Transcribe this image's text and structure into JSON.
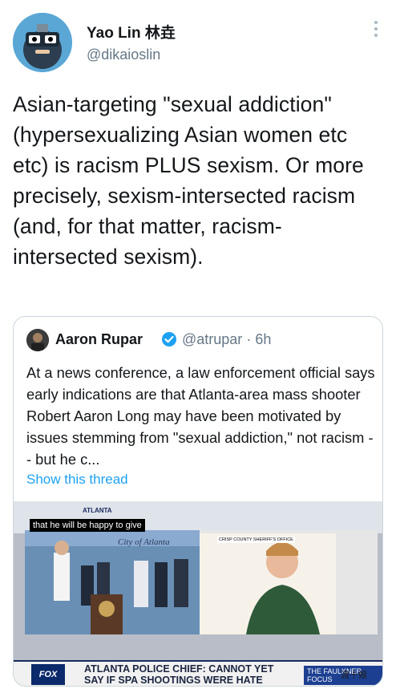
{
  "tweet": {
    "author_name": "Yao Lin 林垚",
    "author_handle": "@dikaioslin",
    "text": "Asian-targeting \"sexual addiction\" (hypersexualizing Asian women etc etc) is racism PLUS sexism. Or more precisely, sexism-intersected racism (and, for that matter, racism-intersected sexism).",
    "more_icon": "more-vertical-icon"
  },
  "quoted": {
    "author_name": "Aaron Rupar",
    "verified_icon": "verified-badge-icon",
    "author_handle": "@atrupar",
    "time": "· 6h",
    "text": "At a news conference, a law enforcement official says early indications are that Atlanta-area mass shooter Robert Aaron Long may have been motivated by issues stemming from \"sexual addiction,\" not racism -- but he c...",
    "show_thread": "Show this thread",
    "media": {
      "top_banner": "ATLANTA",
      "caption": "that he will be happy to give",
      "inset_label": "CRISP COUNTY SHERIFF'S OFFICE",
      "chyron": "ATLANTA POLICE CHIEF: CANNOT YET SAY IF SPA SHOOTINGS WERE HATE CRIMES",
      "network": "FOX",
      "show_badge": "THE FAULKNER FOCUS",
      "watermark": "渡十娘"
    }
  },
  "colors": {
    "link": "#1da1f2",
    "secondary_text": "#657786",
    "border": "#ccd6dd"
  }
}
